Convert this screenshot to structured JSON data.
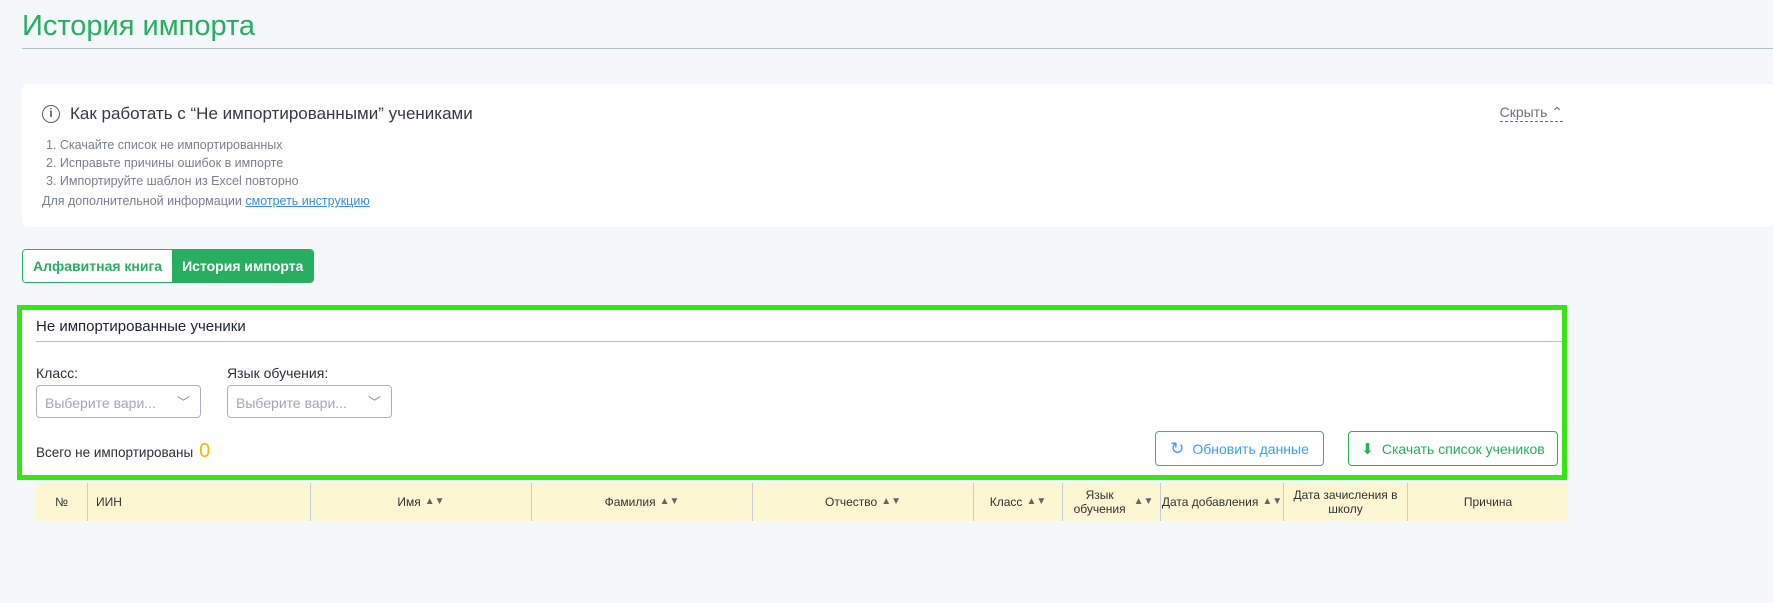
{
  "page_title": "История импорта",
  "info": {
    "title": "Как работать с “Не импортированными” учениками",
    "hide": "Скрыть",
    "steps": [
      "1. Скачайте список не импортированных",
      "2. Исправьте причины ошибок в импорте",
      "3. Импортируйте шаблон из Excel повторно"
    ],
    "more_text": "Для дополнительной информации",
    "more_link": "смотреть инструкцию"
  },
  "tabs": [
    {
      "label": "Алфавитная книга"
    },
    {
      "label": "История импорта"
    }
  ],
  "panel": {
    "title": "Не импортированные ученики",
    "class_label": "Класс:",
    "class_placeholder": "Выберите вари...",
    "lang_label": "Язык обучения:",
    "lang_placeholder": "Выберите вари...",
    "total_label": "Всего не импортированы",
    "total_value": "0",
    "refresh": "Обновить данные",
    "download": "Скачать список учеников"
  },
  "table": {
    "columns": [
      "№",
      "ИИН",
      "Имя",
      "Фамилия",
      "Отчество",
      "Класс",
      "Язык обучения",
      "Дата добавления",
      "Дата зачисления в школу",
      "Причина"
    ]
  }
}
